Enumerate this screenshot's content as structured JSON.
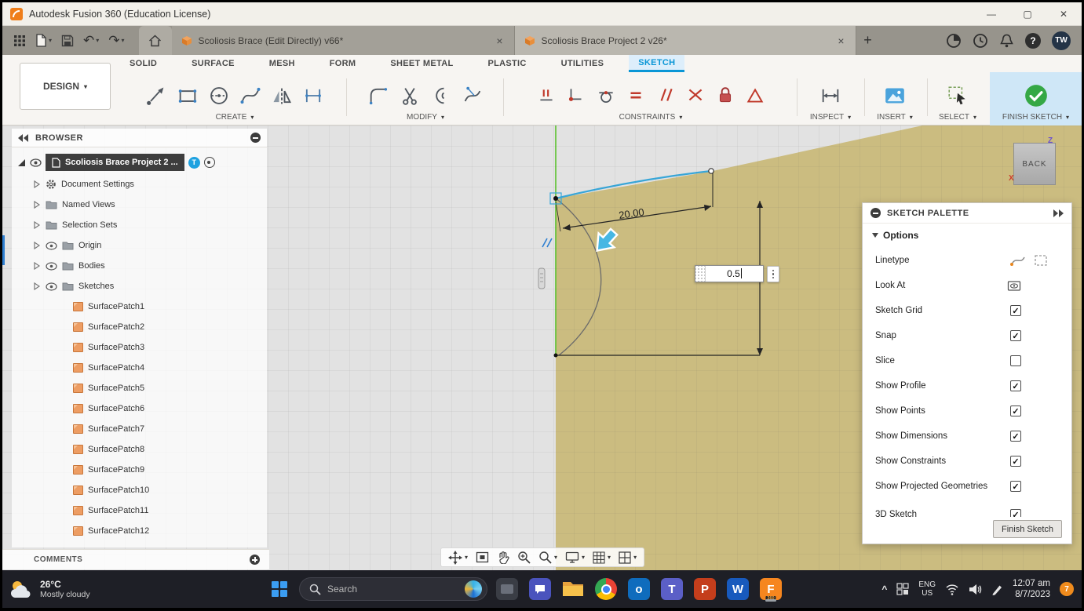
{
  "ui": {
    "caret": "▾",
    "close": "×",
    "plus": "+",
    "minimize": "—",
    "maximize": "▢",
    "close_window": "✕",
    "chevron_up": "^",
    "help": "?",
    "undo": "↶",
    "redo": "↷"
  },
  "window": {
    "title": "Autodesk Fusion 360 (Education License)"
  },
  "tabbar": {
    "tabs": [
      {
        "label": "Scoliosis Brace (Edit Directly) v66*"
      },
      {
        "label": "Scoliosis Brace Project 2 v26*",
        "active": true
      }
    ],
    "avatar": "TW"
  },
  "ribbon": {
    "design_label": "DESIGN",
    "menu_tabs": [
      {
        "label": "SOLID"
      },
      {
        "label": "SURFACE"
      },
      {
        "label": "MESH"
      },
      {
        "label": "FORM"
      },
      {
        "label": "SHEET METAL"
      },
      {
        "label": "PLASTIC"
      },
      {
        "label": "UTILITIES"
      },
      {
        "label": "SKETCH",
        "active": true
      }
    ],
    "groups": {
      "create": "CREATE",
      "modify": "MODIFY",
      "constraints": "CONSTRAINTS",
      "inspect": "INSPECT",
      "insert": "INSERT",
      "select": "SELECT",
      "finish": "FINISH SKETCH"
    }
  },
  "browser": {
    "header": "BROWSER",
    "root": "Scoliosis Brace Project 2 ...",
    "root_badge": "T",
    "items": [
      "Document Settings",
      "Named Views",
      "Selection Sets",
      "Origin",
      "Bodies",
      "Sketches"
    ],
    "patches": [
      "SurfacePatch1",
      "SurfacePatch2",
      "SurfacePatch3",
      "SurfacePatch4",
      "SurfacePatch5",
      "SurfacePatch6",
      "SurfacePatch7",
      "SurfacePatch8",
      "SurfacePatch9",
      "SurfacePatch10",
      "SurfacePatch11",
      "SurfacePatch12"
    ],
    "comments": "COMMENTS"
  },
  "canvas": {
    "dimension_label": "20.00",
    "input_value": "0.5",
    "viewcube_face": "BACK",
    "axis_z": "Z",
    "axis_x": "X"
  },
  "palette": {
    "title": "SKETCH PALETTE",
    "section": "Options",
    "rows": [
      {
        "label": "Linetype"
      },
      {
        "label": "Look At"
      },
      {
        "label": "Sketch Grid",
        "checked": true
      },
      {
        "label": "Snap",
        "checked": true
      },
      {
        "label": "Slice",
        "checked": false
      },
      {
        "label": "Show Profile",
        "checked": true
      },
      {
        "label": "Show Points",
        "checked": true
      },
      {
        "label": "Show Dimensions",
        "checked": true
      },
      {
        "label": "Show Constraints",
        "checked": true
      },
      {
        "label": "Show Projected Geometries",
        "checked": true
      },
      {
        "label": "3D Sketch",
        "checked": true
      }
    ],
    "finish_button": "Finish Sketch"
  },
  "taskbar": {
    "weather_temp": "26°C",
    "weather_condition": "Mostly cloudy",
    "search_placeholder": "Search",
    "lang_top": "ENG",
    "lang_bottom": "US",
    "time": "12:07 am",
    "date": "8/7/2023",
    "badge_count": "7",
    "fusion_badge": "360"
  }
}
